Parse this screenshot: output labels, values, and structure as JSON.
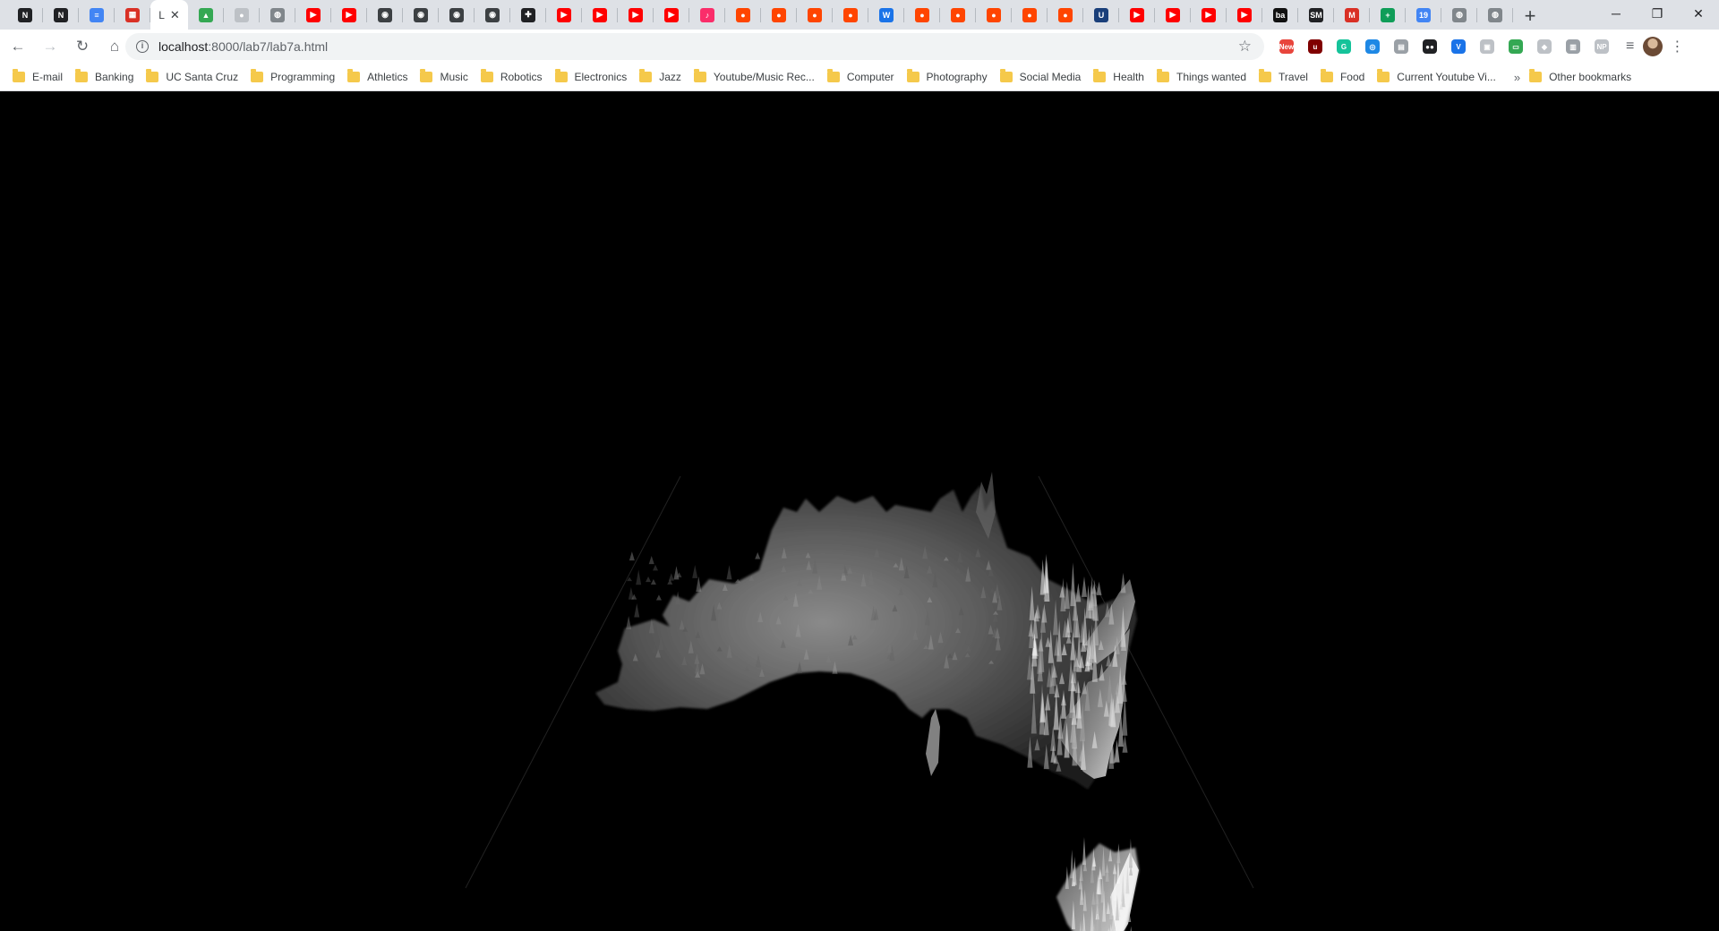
{
  "browser": {
    "active_tab": {
      "label": "L",
      "close": "✕"
    },
    "tabs": [
      {
        "icon": "notion-icon",
        "color": "#202124",
        "glyph": "N"
      },
      {
        "icon": "notion-icon",
        "color": "#202124",
        "glyph": "N"
      },
      {
        "icon": "google-docs-icon",
        "color": "#4285f4",
        "glyph": "≡"
      },
      {
        "icon": "calendar-icon",
        "color": "#d93025",
        "glyph": "▦"
      },
      {
        "icon": "active-page-icon",
        "active": true
      },
      {
        "icon": "google-drive-icon",
        "color": "#34a853",
        "glyph": "▲"
      },
      {
        "icon": "github-icon",
        "color": "#bdc1c6",
        "glyph": "●"
      },
      {
        "icon": "globe-icon",
        "color": "#80868b",
        "glyph": "◍"
      },
      {
        "icon": "youtube-icon",
        "color": "#ff0000",
        "glyph": "▶"
      },
      {
        "icon": "youtube-icon",
        "color": "#ff0000",
        "glyph": "▶"
      },
      {
        "icon": "camera-icon",
        "color": "#3c4043",
        "glyph": "◉"
      },
      {
        "icon": "camera-icon",
        "color": "#3c4043",
        "glyph": "◉"
      },
      {
        "icon": "camera-icon",
        "color": "#3c4043",
        "glyph": "◉"
      },
      {
        "icon": "camera-icon",
        "color": "#3c4043",
        "glyph": "◉"
      },
      {
        "icon": "plus-cross-icon",
        "color": "#202124",
        "glyph": "✚"
      },
      {
        "icon": "youtube-icon",
        "color": "#ff0000",
        "glyph": "▶"
      },
      {
        "icon": "youtube-icon",
        "color": "#ff0000",
        "glyph": "▶"
      },
      {
        "icon": "youtube-icon",
        "color": "#ff0000",
        "glyph": "▶"
      },
      {
        "icon": "youtube-icon",
        "color": "#ff0000",
        "glyph": "▶"
      },
      {
        "icon": "music-icon",
        "color": "#fa2d6a",
        "glyph": "♪"
      },
      {
        "icon": "reddit-icon",
        "color": "#ff4500",
        "glyph": "●"
      },
      {
        "icon": "reddit-icon",
        "color": "#ff4500",
        "glyph": "●"
      },
      {
        "icon": "reddit-icon",
        "color": "#ff4500",
        "glyph": "●"
      },
      {
        "icon": "reddit-icon",
        "color": "#ff4500",
        "glyph": "●"
      },
      {
        "icon": "wiki-icon",
        "color": "#1a73e8",
        "glyph": "W"
      },
      {
        "icon": "reddit-icon",
        "color": "#ff4500",
        "glyph": "●"
      },
      {
        "icon": "reddit-icon",
        "color": "#ff4500",
        "glyph": "●"
      },
      {
        "icon": "reddit-icon",
        "color": "#ff4500",
        "glyph": "●"
      },
      {
        "icon": "reddit-icon",
        "color": "#ff4500",
        "glyph": "●"
      },
      {
        "icon": "reddit-icon",
        "color": "#ff4500",
        "glyph": "●"
      },
      {
        "icon": "ucsc-icon",
        "color": "#1a3f7a",
        "glyph": "U"
      },
      {
        "icon": "youtube-icon",
        "color": "#ff0000",
        "glyph": "▶"
      },
      {
        "icon": "youtube-icon",
        "color": "#ff0000",
        "glyph": "▶"
      },
      {
        "icon": "youtube-icon",
        "color": "#ff0000",
        "glyph": "▶"
      },
      {
        "icon": "youtube-icon",
        "color": "#ff0000",
        "glyph": "▶"
      },
      {
        "icon": "behance-icon",
        "color": "#111111",
        "glyph": "ba"
      },
      {
        "icon": "sm-icon",
        "color": "#202124",
        "glyph": "SM"
      },
      {
        "icon": "gmail-icon",
        "color": "#d93025",
        "glyph": "M"
      },
      {
        "icon": "google-sheets-icon",
        "color": "#0f9d58",
        "glyph": "+"
      },
      {
        "icon": "calendar-19-icon",
        "color": "#4285f4",
        "glyph": "19"
      },
      {
        "icon": "globe-icon",
        "color": "#80868b",
        "glyph": "◍"
      },
      {
        "icon": "globe-icon",
        "color": "#80868b",
        "glyph": "◍"
      }
    ],
    "new_tab_label": "+",
    "window_controls": {
      "minimize": "─",
      "restore": "❐",
      "close": "✕"
    },
    "nav": {
      "back": "←",
      "forward": "→",
      "reload": "↻",
      "home": "⌂"
    },
    "omnibox": {
      "info": "i",
      "host": "localhost",
      "path": ":8000/lab7/lab7a.html",
      "star": "☆"
    },
    "extensions": [
      {
        "icon": "new-extension-icon",
        "color": "#e8453c",
        "glyph": "New"
      },
      {
        "icon": "ublock-icon",
        "color": "#800000",
        "glyph": "u"
      },
      {
        "icon": "grammarly-icon",
        "color": "#15c39a",
        "glyph": "G"
      },
      {
        "icon": "circle-extension-icon",
        "color": "#1e88e5",
        "glyph": "◎"
      },
      {
        "icon": "reader-icon",
        "color": "#9aa0a6",
        "glyph": "▤"
      },
      {
        "icon": "tampermonkey-icon",
        "color": "#202124",
        "glyph": "●●"
      },
      {
        "icon": "vuejs-icon",
        "color": "#1a73e8",
        "glyph": "V"
      },
      {
        "icon": "puzzle-icon",
        "color": "#bdc1c6",
        "glyph": "▣"
      },
      {
        "icon": "screen-extension-icon",
        "color": "#34a853",
        "glyph": "▭"
      },
      {
        "icon": "shield-extension-icon",
        "color": "#bdc1c6",
        "glyph": "◆"
      },
      {
        "icon": "chart-extension-icon",
        "color": "#9aa0a6",
        "glyph": "▥"
      },
      {
        "icon": "np-extension-icon",
        "color": "#bdc1c6",
        "glyph": "NP"
      }
    ],
    "menu": {
      "reading_list": "≡",
      "kebab": "⋮"
    }
  },
  "bookmarks": [
    "E-mail",
    "Banking",
    "UC Santa Cruz",
    "Programming",
    "Athletics",
    "Music",
    "Robotics",
    "Electronics",
    "Jazz",
    "Youtube/Music Rec...",
    "Computer",
    "Photography",
    "Social Media",
    "Health",
    "Things wanted",
    "Travel",
    "Food",
    "Current Youtube Vi..."
  ],
  "bookmarks_more": "»",
  "other_bookmarks": "Other bookmarks",
  "viewport": {
    "scene": "3d-terrain-heightmap-australia",
    "background": "#000000"
  }
}
